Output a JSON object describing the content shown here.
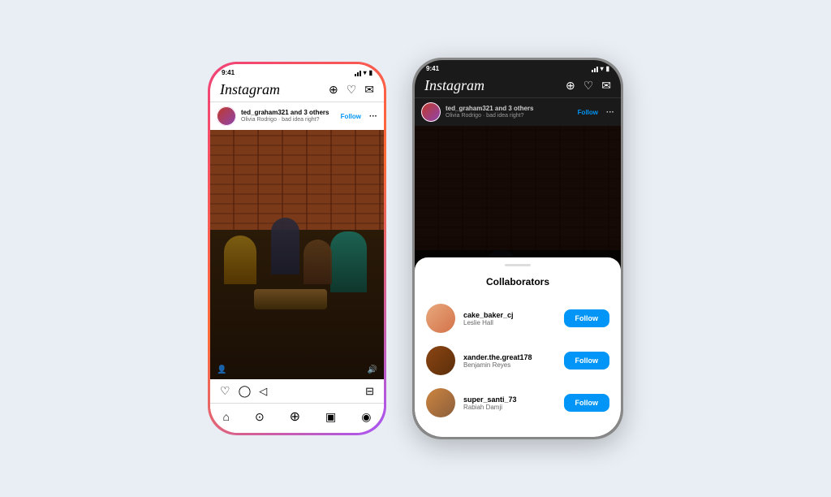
{
  "app": {
    "name": "Instagram"
  },
  "phone1": {
    "status_bar": {
      "time": "9:41"
    },
    "nav": {
      "logo": "Instagram",
      "icons": [
        "plus-square",
        "heart",
        "messenger"
      ]
    },
    "post": {
      "username": "ted_graham321 and 3 others",
      "subtitle": "Olivia Rodrigo · bad idea right?",
      "follow_label": "Follow",
      "more_icon": "•••"
    },
    "actions": {
      "like": "♡",
      "comment": "○",
      "share": "▷",
      "save": "⊟"
    },
    "bottom_nav": [
      "home",
      "search",
      "add",
      "reels",
      "profile"
    ]
  },
  "phone2": {
    "status_bar": {
      "time": "9:41"
    },
    "nav": {
      "logo": "Instagram",
      "icons": [
        "plus-square",
        "heart",
        "messenger"
      ]
    },
    "post": {
      "username": "ted_graham321 and 3 others",
      "subtitle": "Olivia Rodrigo · bad idea right?",
      "follow_label": "Follow",
      "more_icon": "•••"
    },
    "sheet": {
      "title": "Collaborators",
      "collaborators": [
        {
          "username": "cake_baker_cj",
          "name": "Leslie Hall",
          "follow_label": "Follow",
          "avatar_color": "av1"
        },
        {
          "username": "xander.the.great178",
          "name": "Benjamin Reyes",
          "follow_label": "Follow",
          "avatar_color": "av2"
        },
        {
          "username": "super_santi_73",
          "name": "Rabiah Damji",
          "follow_label": "Follow",
          "avatar_color": "av3"
        }
      ]
    }
  }
}
